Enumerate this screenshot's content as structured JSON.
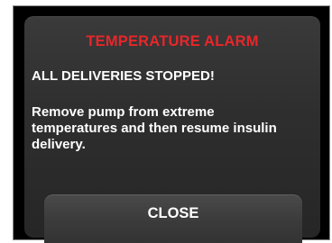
{
  "alarm": {
    "title": "TEMPERATURE ALARM",
    "subtitle": "ALL DELIVERIES STOPPED!",
    "message": "Remove pump from extreme temperatures and then resume insulin delivery.",
    "close_label": "CLOSE"
  },
  "colors": {
    "title": "#e8262a",
    "background": "#000000",
    "dialog": "#2f2f2f",
    "text": "#ffffff"
  }
}
